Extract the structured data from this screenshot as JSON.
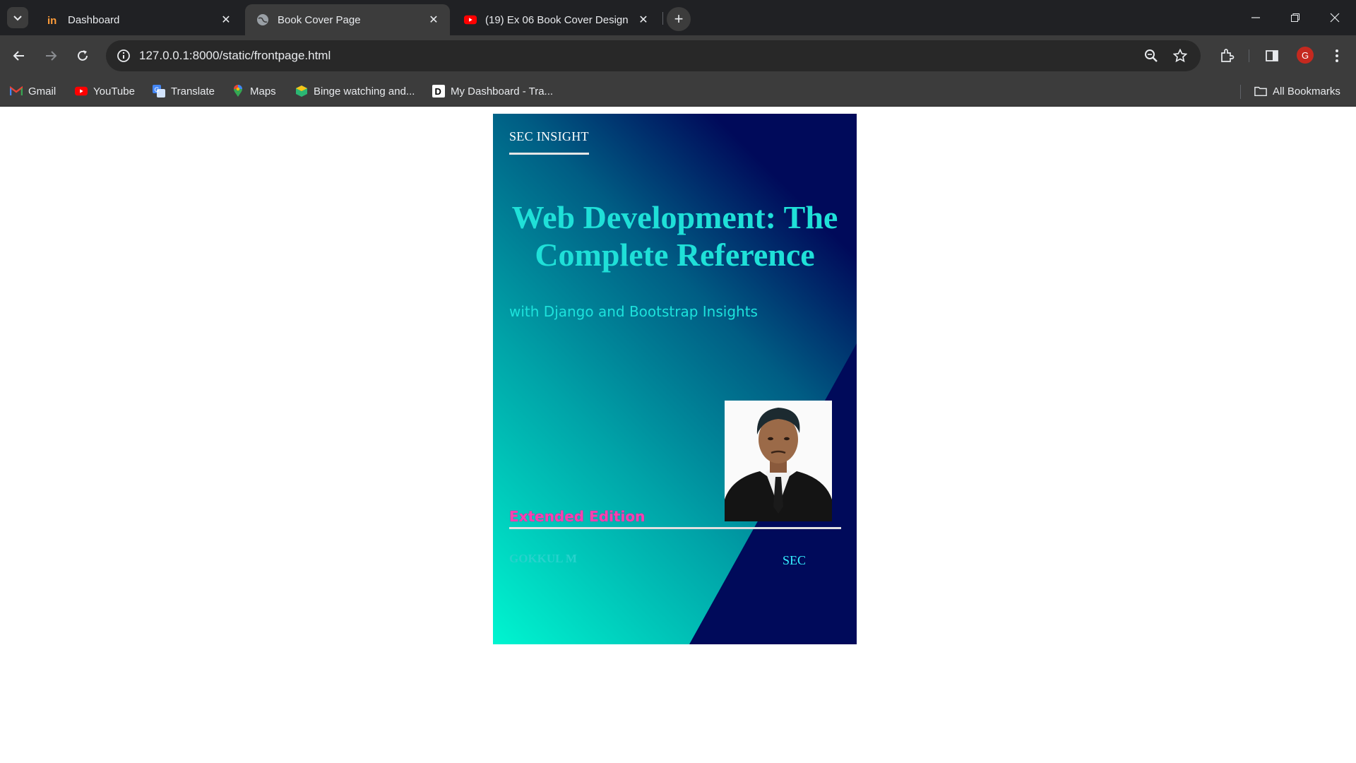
{
  "browser": {
    "tabs": [
      {
        "title": "Dashboard",
        "favicon": "invision-icon"
      },
      {
        "title": "Book Cover Page",
        "favicon": "globe-icon",
        "active": true
      },
      {
        "title": "(19) Ex 06 Book Cover Design u",
        "favicon": "youtube-icon"
      }
    ],
    "url": "127.0.0.1:8000/static/frontpage.html",
    "profile_initial": "G",
    "bookmarks": [
      {
        "label": "Gmail",
        "icon": "gmail-icon"
      },
      {
        "label": "YouTube",
        "icon": "youtube-icon"
      },
      {
        "label": "Translate",
        "icon": "translate-icon"
      },
      {
        "label": "Maps",
        "icon": "maps-icon"
      },
      {
        "label": "Binge watching and...",
        "icon": "binge-icon"
      },
      {
        "label": "My Dashboard - Tra...",
        "icon": "d-icon"
      }
    ],
    "all_bookmarks": "All Bookmarks"
  },
  "cover": {
    "publisher": "SEC INSIGHT",
    "title": "Web Development: The Complete Reference",
    "subtitle": "with Django and Bootstrap Insights",
    "edition": "Extended Edition",
    "author": "GOKKUL M",
    "organization": "SEC",
    "colors": {
      "dark_navy": "#000a5a",
      "teal": "#00a3a8",
      "aqua": "#00f5d0",
      "title": "#1fe0d8",
      "edition": "#ff3fb0"
    }
  }
}
